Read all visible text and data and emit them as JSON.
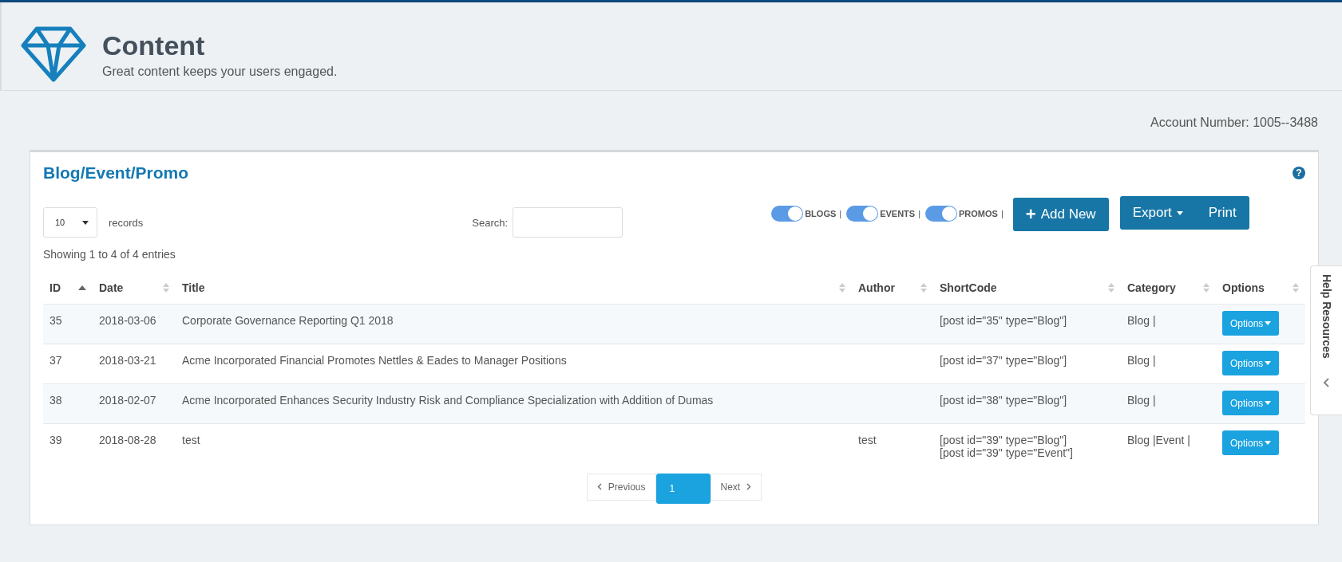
{
  "header": {
    "title": "Content",
    "subtitle": "Great content keeps your users engaged."
  },
  "account": "Account Number: 1005--3488",
  "card": {
    "title": "Blog/Event/Promo",
    "help": "?"
  },
  "length": {
    "value": "10",
    "label": "records"
  },
  "search": {
    "label": "Search:"
  },
  "toggles": [
    {
      "label": "BLOGS",
      "on": true,
      "sep": "|"
    },
    {
      "label": "EVENTS",
      "on": true,
      "sep": "|"
    },
    {
      "label": "PROMOS",
      "on": true,
      "sep": "|"
    }
  ],
  "add_button": {
    "icon": "+",
    "label": "Add New"
  },
  "export_button": "Export",
  "print_button": "Print",
  "info": "Showing 1 to 4 of 4 entries",
  "table": {
    "columns": [
      {
        "label": "ID",
        "sorted": true
      },
      {
        "label": "Date",
        "sorted": false
      },
      {
        "label": "Title",
        "sorted": false
      },
      {
        "label": "Author",
        "sorted": false
      },
      {
        "label": "ShortCode",
        "sorted": false
      },
      {
        "label": "Category",
        "sorted": false
      },
      {
        "label": "Options",
        "sorted": false
      }
    ],
    "rows": [
      {
        "id": "35",
        "date": "2018-03-06",
        "title": "Corporate Governance Reporting Q1 2018",
        "author": "",
        "shortcode": [
          "[post id=\"35\" type=\"Blog\"]"
        ],
        "category": "Blog |",
        "options": "Options"
      },
      {
        "id": "37",
        "date": "2018-03-21",
        "title": "Acme Incorporated Financial Promotes Nettles & Eades to Manager Positions",
        "author": "",
        "shortcode": [
          "[post id=\"37\" type=\"Blog\"]"
        ],
        "category": "Blog |",
        "options": "Options"
      },
      {
        "id": "38",
        "date": "2018-02-07",
        "title": "Acme Incorporated Enhances Security Industry Risk and Compliance Specialization with Addition of Dumas",
        "author": "",
        "shortcode": [
          "[post id=\"38\" type=\"Blog\"]"
        ],
        "category": "Blog |",
        "options": "Options"
      },
      {
        "id": "39",
        "date": "2018-08-28",
        "title": "test",
        "author": "test",
        "shortcode": [
          "[post id=\"39\" type=\"Blog\"]",
          "[post id=\"39\" type=\"Event\"]"
        ],
        "category": "Blog |Event |",
        "options": "Options"
      }
    ]
  },
  "pagination": [
    {
      "label": "Previous",
      "kind": "prev",
      "selected": false
    },
    {
      "label": "1",
      "kind": "page",
      "selected": true
    },
    {
      "label": "Next",
      "kind": "next",
      "selected": false
    }
  ],
  "help_tab": "Help Resources"
}
